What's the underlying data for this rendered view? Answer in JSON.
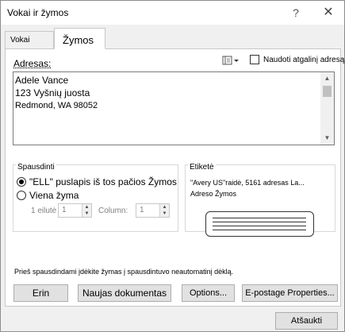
{
  "window": {
    "title": "Vokai ir žymos",
    "help": "?",
    "close": "✕"
  },
  "tabs": [
    {
      "label": "Vokai",
      "active": false
    },
    {
      "label": "Žymos",
      "active": true
    }
  ],
  "address": {
    "label": "Adresas:",
    "return_address_label": "Naudoti atgalinį adresą",
    "return_address_checked": false,
    "lines": [
      "Adele Vance",
      "123 Vyšnių juosta",
      "Redmond, WA 98052"
    ]
  },
  "print": {
    "group_label": "Spausdinti",
    "full_page_label": "\"ELL\" puslapis iš tos pačios Žymos",
    "full_page_selected": true,
    "single_label": "Viena žyma",
    "single_selected": false,
    "row_label": "1 eilutė",
    "row_value": "1",
    "column_label": "Column:",
    "column_value": "1"
  },
  "label": {
    "group_label": "Etiketė",
    "desc_line1": "\"Avery US\"raidė, 5161 adresas La...",
    "desc_line2": "Adreso Žymos"
  },
  "note": "Prieš spausdindami įdėkite žymas į spausdintuvo neautomatinį dėklą.",
  "buttons": {
    "print": "Erin",
    "new_document": "Naujas dokumentas",
    "options": "Options...",
    "epostage": "E-postage Properties...",
    "cancel": "Atšaukti"
  },
  "icons": {
    "help": "help-icon",
    "close": "close-icon",
    "address_book": "address-book-icon",
    "scroll_up": "chevron-up-icon",
    "scroll_down": "chevron-down-icon"
  }
}
